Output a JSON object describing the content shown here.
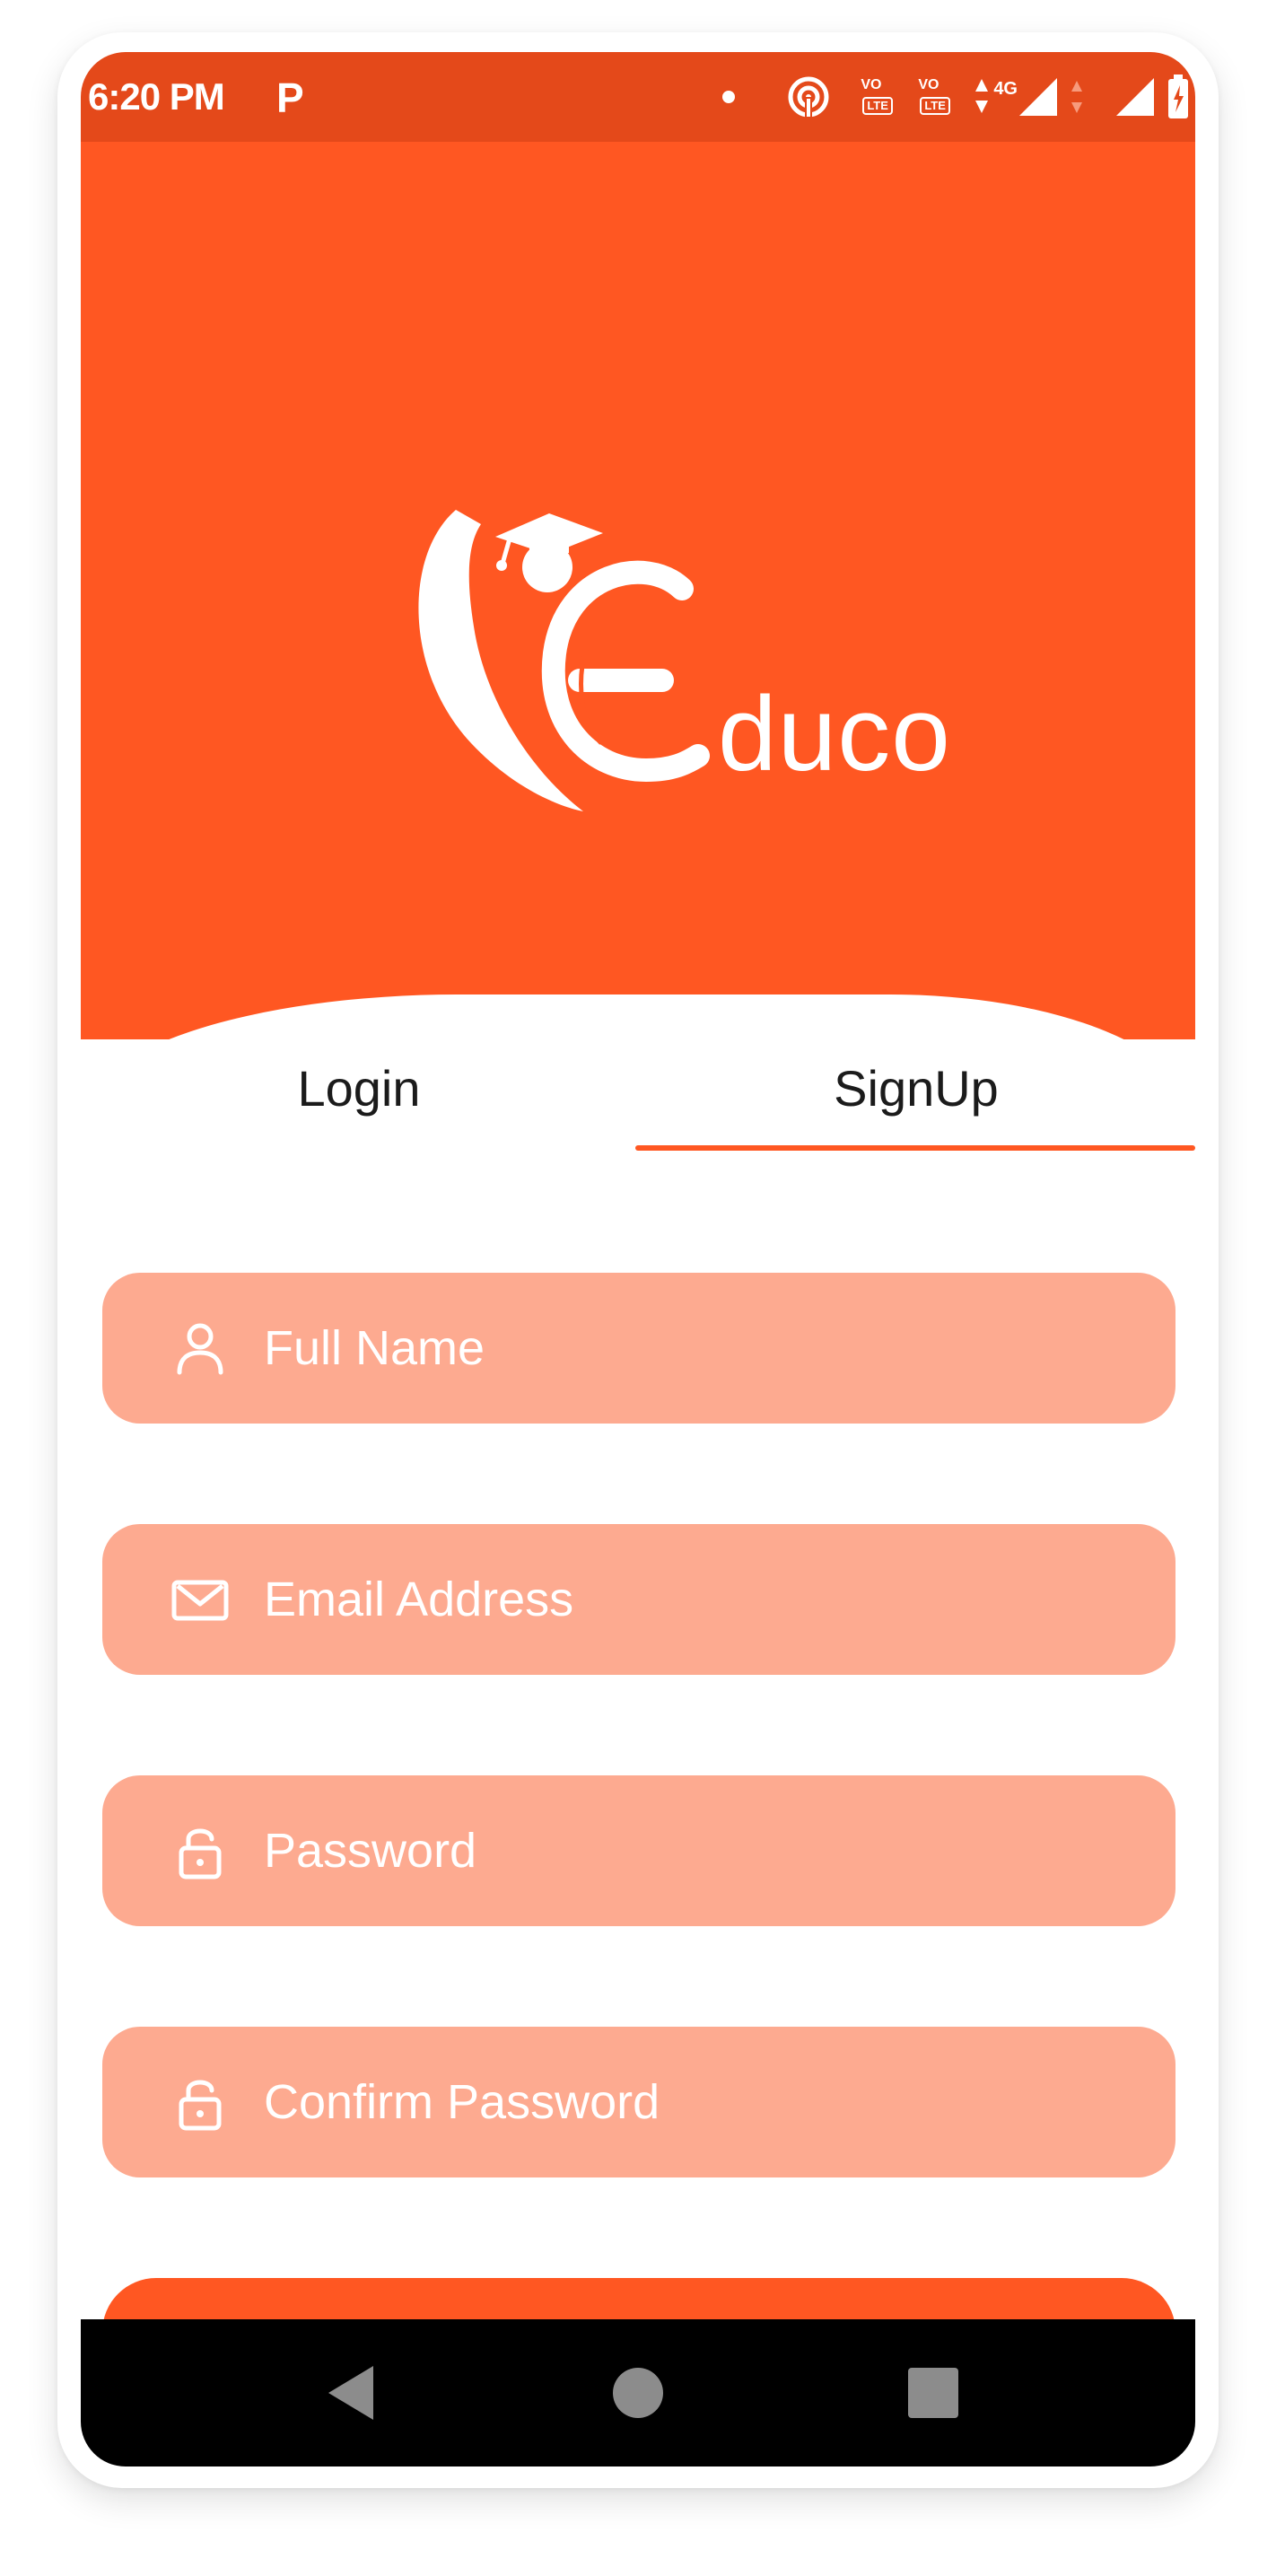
{
  "status_bar": {
    "time": "6:20 PM",
    "app_indicator": "P",
    "sim1_vo": "VO",
    "sim1_lte": "LTE",
    "sim2_vo": "VO",
    "sim2_lte": "LTE",
    "network": "4G",
    "icons": [
      "notification-dot-icon",
      "hotspot-icon",
      "volte-icon",
      "volte-icon",
      "data-arrows-icon",
      "signal-icon",
      "signal-icon",
      "battery-charging-icon"
    ]
  },
  "brand": {
    "name": "Educo",
    "logo_icon": "graduate-cap-logo-icon"
  },
  "tabs": [
    {
      "label": "Login",
      "active": false
    },
    {
      "label": "SignUp",
      "active": true
    }
  ],
  "form": {
    "full_name": {
      "placeholder": "Full Name",
      "value": "",
      "icon": "person-icon"
    },
    "email": {
      "placeholder": "Email Address",
      "value": "",
      "icon": "mail-icon"
    },
    "password": {
      "placeholder": "Password",
      "value": "",
      "icon": "lock-icon"
    },
    "confirm_password": {
      "placeholder": "Confirm Password",
      "value": "",
      "icon": "lock-icon"
    }
  },
  "nav": {
    "icons": [
      "back-triangle-icon",
      "home-circle-icon",
      "recents-square-icon"
    ]
  },
  "colors": {
    "status_bar": "#e4491a",
    "primary": "#ff5722",
    "field_bg": "#fdaa90",
    "text_dark": "#1b1b1b"
  }
}
